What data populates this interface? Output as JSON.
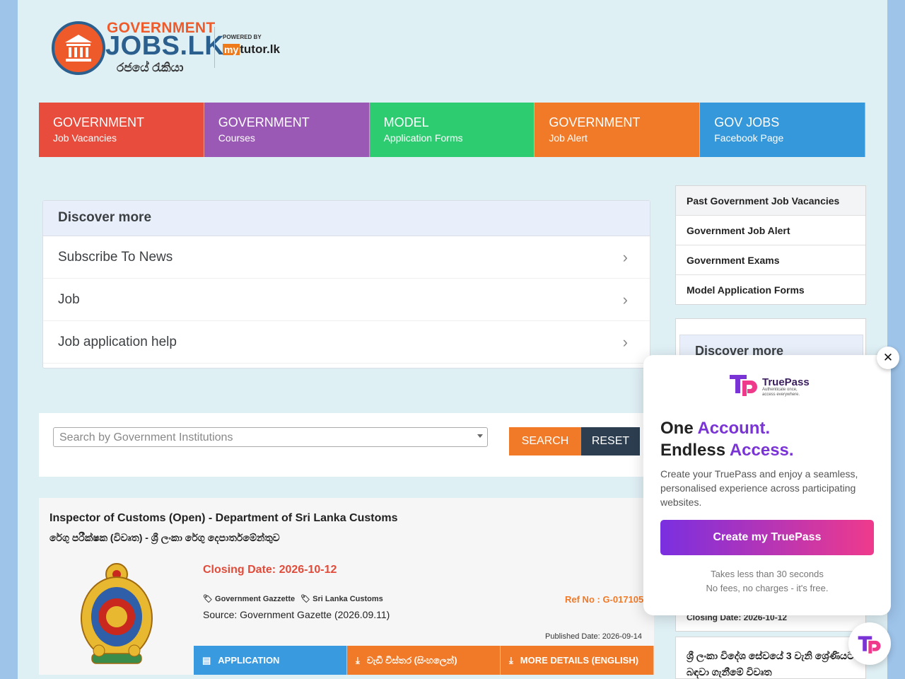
{
  "logo": {
    "line1": "GOVERNMENT",
    "line2": "JOBS.LK",
    "line3": "රජයේ රැකියා",
    "powered_by": "POWERED BY",
    "partner_my": "my",
    "partner_rest": "tutor.lk"
  },
  "menu": [
    {
      "title": "GOVERNMENT",
      "subtitle": "Job Vacancies",
      "color": "#e74c3c"
    },
    {
      "title": "GOVERNMENT",
      "subtitle": "Courses",
      "color": "#9b59b6"
    },
    {
      "title": "MODEL",
      "subtitle": "Application Forms",
      "color": "#2ecc71"
    },
    {
      "title": "GOVERNMENT",
      "subtitle": "Job Alert",
      "color": "#f07a28"
    },
    {
      "title": "GOV JOBS",
      "subtitle": "Facebook Page",
      "color": "#3498db"
    }
  ],
  "discover": {
    "heading": "Discover more",
    "items": [
      "Subscribe To News",
      "Job",
      "Job application help"
    ]
  },
  "sidebar": {
    "links": [
      "Past Government Job Vacancies",
      "Government Job Alert",
      "Government Exams",
      "Model Application Forms"
    ],
    "discover_heading": "Discover more",
    "closing_snippet": "Closing Date: 2026-10-12",
    "job_snippet": "ශ්‍රී ලංකා විදේශ සේවයේ 3 වැනි ශ්‍රේණියට බඳවා ගැනීමේ විවෘත"
  },
  "search": {
    "placeholder": "Search by Government Institutions",
    "search_label": "SEARCH",
    "reset_label": "RESET"
  },
  "job": {
    "title": "Inspector of Customs (Open) - Department of Sri Lanka Customs",
    "title_si": "රේගු පරීක්ෂක (විවෘත) - ශ්‍රී ලංකා රේගු දෙපාර්තමේන්තුව",
    "closing": "Closing Date: 2026-10-12",
    "tags": [
      "Government Gazzette",
      "Sri Lanka Customs"
    ],
    "ref": "Ref No : G-017105",
    "source": "Source: Government Gazette (2026.09.11)",
    "published": "Published Date: 2026-09-14",
    "actions": [
      "APPLICATION",
      "වැඩි විස්තර (සිංහලෙන්)",
      "MORE DETAILS (ENGLISH)"
    ]
  },
  "truepass": {
    "brand": "TruePass",
    "tagline1": "Authenticate once,",
    "tagline2": "access everywhere.",
    "h_one": "One ",
    "h_account": "Account.",
    "h_endless": "Endless ",
    "h_access": "Access.",
    "body": "Create your TruePass and enjoy a seamless, personalised experience across participating websites.",
    "button": "Create my TruePass",
    "note1": "Takes less than 30 seconds",
    "note2": "No fees, no charges - it's free.",
    "close": "✕"
  }
}
